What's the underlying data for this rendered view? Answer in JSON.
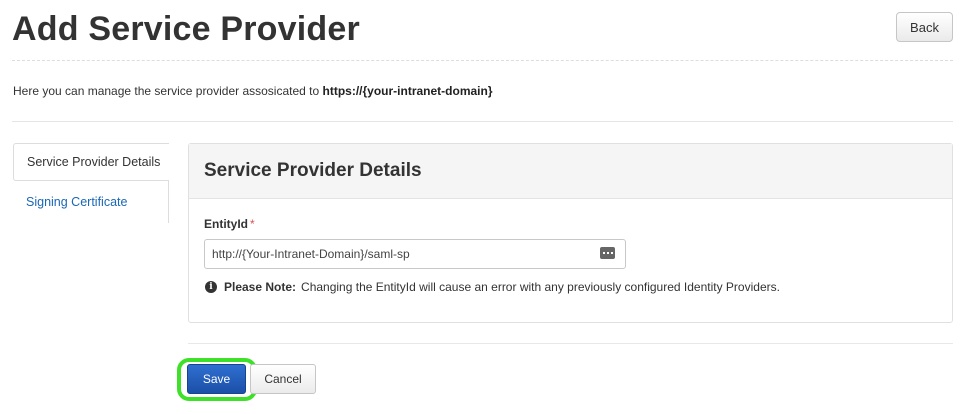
{
  "header": {
    "title": "Add Service Provider",
    "back_label": "Back"
  },
  "intro": {
    "text": "Here you can manage the service provider assosicated to ",
    "domain": "https://{your-intranet-domain}"
  },
  "tabs": [
    {
      "label": "Service Provider Details",
      "active": true
    },
    {
      "label": "Signing Certificate",
      "active": false
    }
  ],
  "panel": {
    "title": "Service Provider Details",
    "field_label": "EntityId",
    "required_mark": "*",
    "entity_id_value": "http://{Your-Intranet-Domain}/saml-sp",
    "note_label": "Please Note:",
    "note_text": "Changing the EntityId will cause an error with any previously configured Identity Providers."
  },
  "footer": {
    "save_label": "Save",
    "cancel_label": "Cancel"
  },
  "colors": {
    "primary": "#1b4fa8",
    "link": "#1a67b5",
    "highlight": "#3fe02a",
    "required": "#d9534f"
  }
}
